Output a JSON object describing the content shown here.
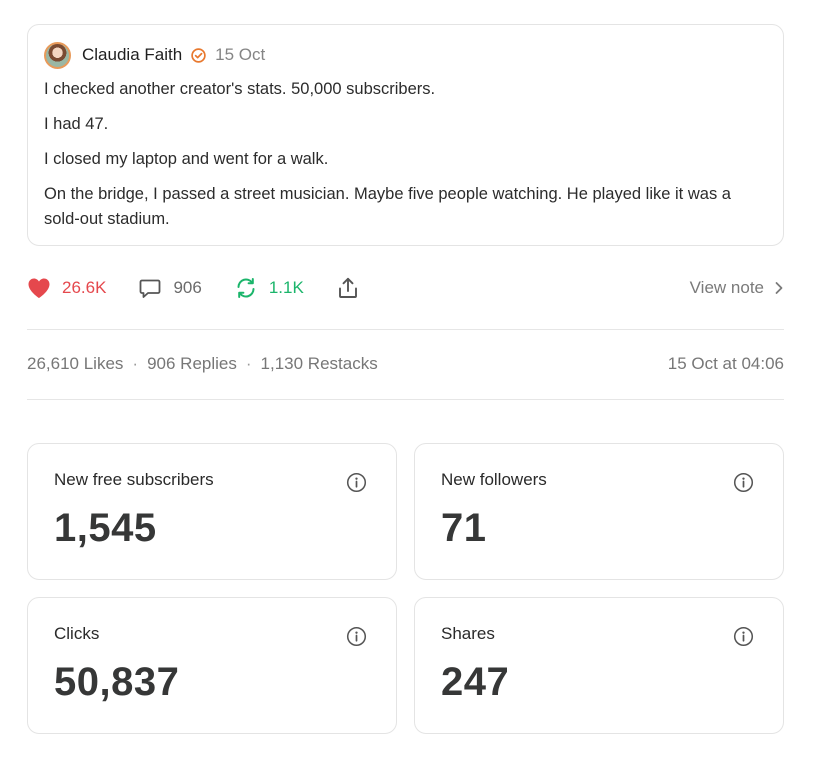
{
  "note": {
    "author": "Claudia Faith",
    "date": "15 Oct",
    "lines": [
      "I checked another creator's stats. 50,000 subscribers.",
      "I had 47.",
      "I closed my laptop and went for a walk.",
      "On the bridge, I passed a street musician. Maybe five people watching. He played like it was a sold-out stadium."
    ]
  },
  "actions": {
    "likes": "26.6K",
    "replies": "906",
    "restacks": "1.1K",
    "view_note": "View note"
  },
  "stats": {
    "likes": "26,610 Likes",
    "replies": "906 Replies",
    "restacks": "1,130 Restacks",
    "separator": "·",
    "timestamp": "15 Oct at 04:06"
  },
  "metrics": [
    {
      "label": "New free subscribers",
      "value": "1,545"
    },
    {
      "label": "New followers",
      "value": "71"
    },
    {
      "label": "Clicks",
      "value": "50,837"
    },
    {
      "label": "Shares",
      "value": "247"
    }
  ],
  "colors": {
    "like": "#e5484d",
    "restack": "#1bb56b",
    "verified": "#e8792f"
  },
  "icons": [
    "heart-icon",
    "comment-icon",
    "restack-icon",
    "share-icon",
    "chevron-right-icon",
    "info-icon",
    "verified-icon"
  ]
}
